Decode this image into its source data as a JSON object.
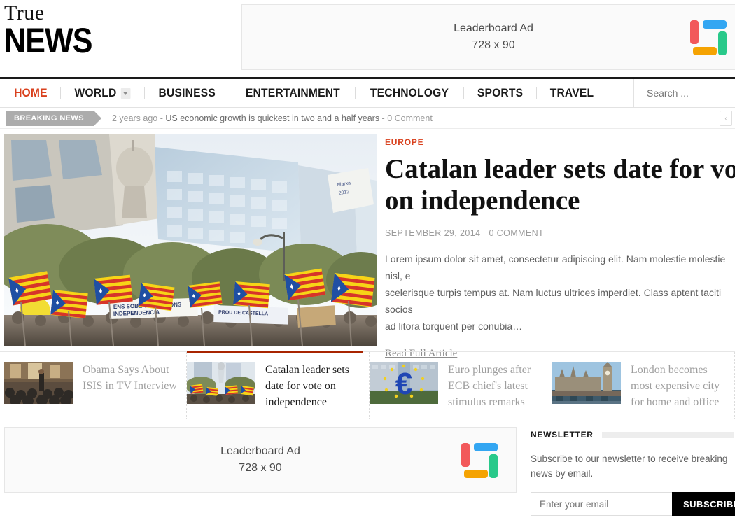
{
  "site": {
    "logo_line1": "True",
    "logo_line2": "NEWS"
  },
  "ads": {
    "top": {
      "line1": "Leaderboard Ad",
      "line2": "728 x 90"
    },
    "bottom": {
      "line1": "Leaderboard Ad",
      "line2": "728 x 90"
    },
    "logo_colors": {
      "red": "#f2585b",
      "blue": "#33a6f2",
      "green": "#29c98a",
      "orange": "#f5a302"
    }
  },
  "nav": {
    "items": [
      {
        "label": "HOME",
        "active": true,
        "dropdown": false
      },
      {
        "label": "WORLD",
        "active": false,
        "dropdown": true
      },
      {
        "label": "BUSINESS",
        "active": false,
        "dropdown": false
      },
      {
        "label": "ENTERTAINMENT",
        "active": false,
        "dropdown": false
      },
      {
        "label": "TECHNOLOGY",
        "active": false,
        "dropdown": false
      },
      {
        "label": "SPORTS",
        "active": false,
        "dropdown": false
      },
      {
        "label": "TRAVEL",
        "active": false,
        "dropdown": false
      }
    ],
    "active_color": "#d9411e",
    "search_placeholder": "Search ...",
    "search_value": ""
  },
  "breaking": {
    "tag": "BREAKING NEWS",
    "time": "2 years ago",
    "sep1": " - ",
    "title": "US economic growth is quickest in two and a half years",
    "sep2": " - ",
    "comments": "0 Comment",
    "prev_arrow": "‹"
  },
  "hero": {
    "category": "EUROPE",
    "category_color": "#d9411e",
    "title": "Catalan leader sets date for vote on independence",
    "title_line1": "Catalan leader sets date for vote",
    "title_line2": "on independence",
    "date": "SEPTEMBER 29, 2014",
    "comments": "0 COMMENT",
    "excerpt": "Lorem ipsum dolor sit amet, consectetur adipiscing elit. Nam molestie molestie nisl, e\nscelerisque turpis tempus at. Nam luctus ultrices imperdiet. Class aptent taciti socios\nad litora torquent per conubia…",
    "read_more": "Read Full Article",
    "image_alt": "Catalan independence rally with Estelada flags"
  },
  "thumbs": [
    {
      "title": "Obama Says About ISIS in TV Interview",
      "active": false,
      "image": "obama-press-conference"
    },
    {
      "title": "Catalan leader sets date for vote on independence",
      "active": true,
      "image": "catalan-rally"
    },
    {
      "title": "Euro plunges after ECB chief's latest stimulus remarks",
      "active": false,
      "image": "euro-sign-sculpture"
    },
    {
      "title": "London becomes most expensive city for home and office",
      "active": false,
      "image": "westminster-big-ben"
    }
  ],
  "newsletter": {
    "title": "NEWSLETTER",
    "description": "Subscribe to our newsletter to receive breaking news by email.",
    "input_placeholder": "Enter your email",
    "input_value": "",
    "button": "SUBSCRIBE"
  }
}
